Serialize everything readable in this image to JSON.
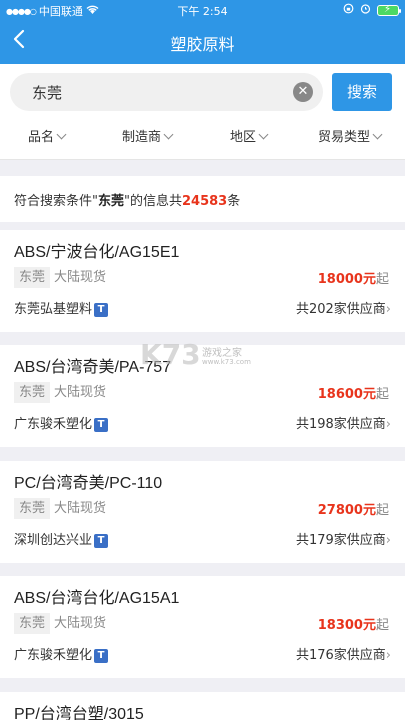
{
  "status_bar": {
    "carrier": "中国联通",
    "time": "下午 2:54"
  },
  "nav": {
    "title": "塑胶原料",
    "back_icon": "chevron-left-icon"
  },
  "search": {
    "value": "东莞",
    "button_label": "搜索"
  },
  "filters": [
    {
      "label": "品名"
    },
    {
      "label": "制造商"
    },
    {
      "label": "地区"
    },
    {
      "label": "贸易类型"
    }
  ],
  "result": {
    "prefix": "符合搜索条件\"",
    "keyword": "东莞",
    "middle": "\"的信息共",
    "count": "24583",
    "suffix": "条"
  },
  "listings": [
    {
      "name": "ABS/宁波台化/AG15E1",
      "location": "东莞",
      "stock": "大陆现货",
      "price": "18000元",
      "price_unit": "起",
      "company": "东莞弘基塑料",
      "badge": "T",
      "suppliers": "共202家供应商"
    },
    {
      "name": "ABS/台湾奇美/PA-757",
      "location": "东莞",
      "stock": "大陆现货",
      "price": "18600元",
      "price_unit": "起",
      "company": "广东骏禾塑化",
      "badge": "T",
      "suppliers": "共198家供应商"
    },
    {
      "name": "PC/台湾奇美/PC-110",
      "location": "东莞",
      "stock": "大陆现货",
      "price": "27800元",
      "price_unit": "起",
      "company": "深圳创达兴业",
      "badge": "T",
      "suppliers": "共179家供应商"
    },
    {
      "name": "ABS/台湾台化/AG15A1",
      "location": "东莞",
      "stock": "大陆现货",
      "price": "18300元",
      "price_unit": "起",
      "company": "广东骏禾塑化",
      "badge": "T",
      "suppliers": "共176家供应商"
    },
    {
      "name": "PP/台湾台塑/3015"
    }
  ],
  "watermark": {
    "logo": "K73",
    "text": "游戏之家",
    "url": "www.k73.com"
  },
  "colors": {
    "primary": "#2e96e6",
    "price": "#e8341c",
    "badge": "#3a6fc6"
  }
}
